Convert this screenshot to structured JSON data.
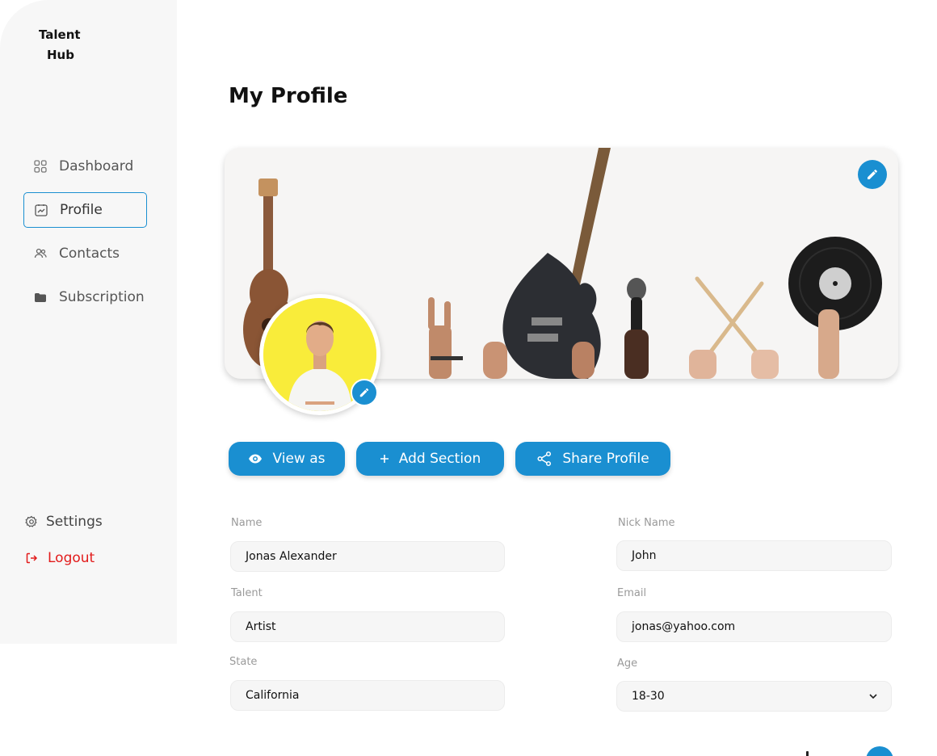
{
  "brand": {
    "line1": "Talent",
    "line2": "Hub"
  },
  "sidebar": {
    "items": [
      {
        "label": "Dashboard",
        "icon": "dashboard-grid-icon"
      },
      {
        "label": "Profile",
        "icon": "profile-card-icon",
        "active": true
      },
      {
        "label": "Contacts",
        "icon": "contacts-icon"
      },
      {
        "label": "Subscription",
        "icon": "folder-icon"
      }
    ],
    "settings": "Settings",
    "logout": "Logout"
  },
  "page": {
    "title": "My Profile"
  },
  "actions": {
    "view_as": "View as",
    "add_section": "Add Section",
    "share_profile": "Share Profile"
  },
  "form": {
    "name": {
      "label": "Name",
      "value": "Jonas Alexander"
    },
    "nick_name": {
      "label": "Nick Name",
      "value": "John"
    },
    "talent": {
      "label": "Talent",
      "value": "Artist"
    },
    "email": {
      "label": "Email",
      "value": "jonas@yahoo.com"
    },
    "state": {
      "label": "State",
      "value": "California"
    },
    "age": {
      "label": "Age",
      "value": "18-30"
    }
  },
  "colors": {
    "accent": "#1a8fd1",
    "logout": "#e21b1b",
    "avatar_bg": "#f9ec3a"
  }
}
